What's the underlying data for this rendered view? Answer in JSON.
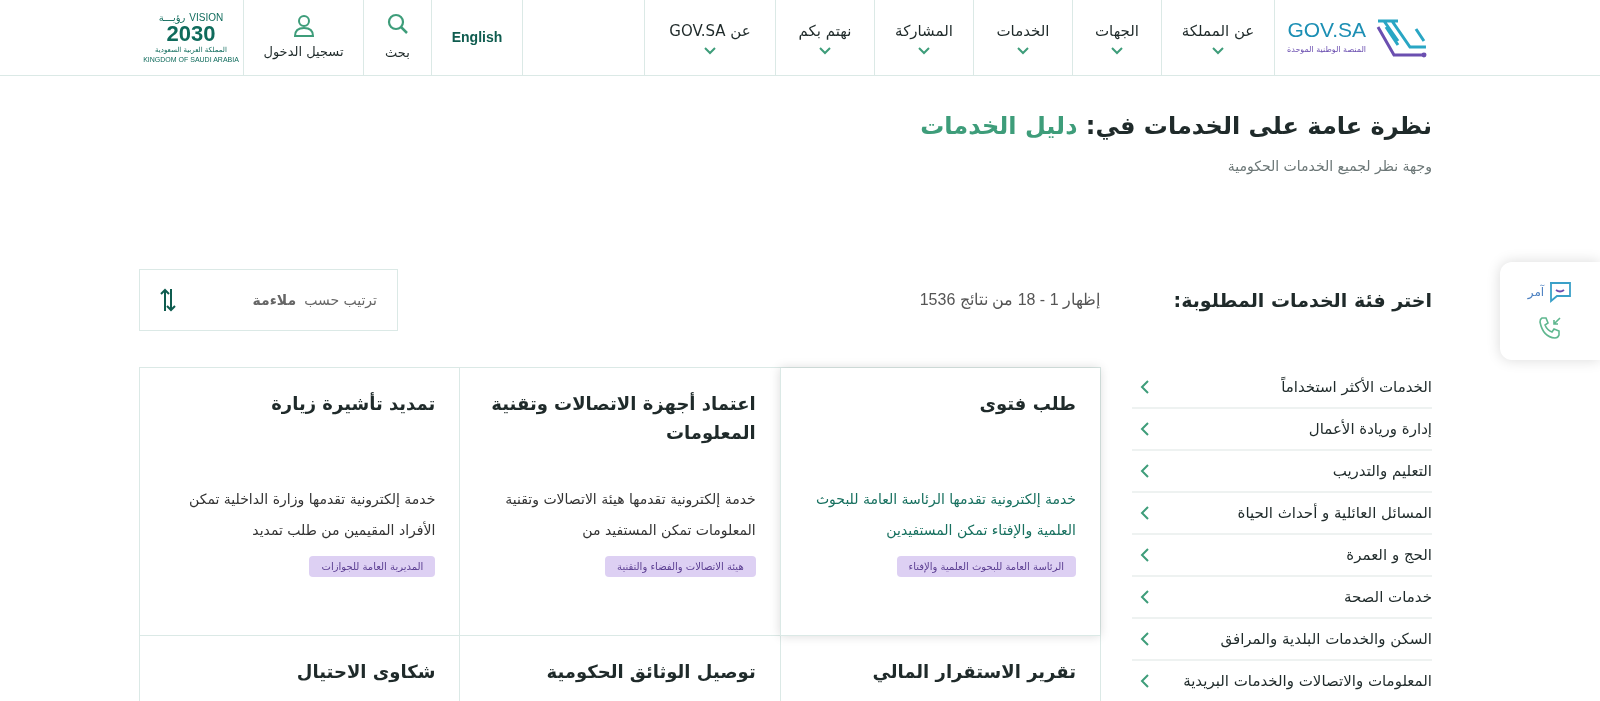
{
  "header": {
    "logo": {
      "name": "GOV.SA",
      "tagline": "المنصة الوطنية الموحدة"
    },
    "nav": [
      {
        "label": "عن المملكة"
      },
      {
        "label": "الجهات"
      },
      {
        "label": "الخدمات"
      },
      {
        "label": "المشاركة"
      },
      {
        "label": "نهتم بكم"
      },
      {
        "label": "عن GOV.SA"
      }
    ],
    "language": "English",
    "search": "بحث",
    "login": "تسجيل الدخول",
    "vision": {
      "word": "VISION",
      "arabic": "رؤيـــة",
      "year": "2030",
      "kingdom_ar": "المملكة العربية السعودية",
      "kingdom_en": "KINGDOM OF SAUDI ARABIA"
    }
  },
  "page": {
    "title": "نظرة عامة على الخدمات في:",
    "title_highlight": "دليل الخدمات",
    "subtitle": "وجهة نظر لجميع الخدمات الحكومية"
  },
  "filter": {
    "heading": "اختر فئة الخدمات المطلوبة:",
    "count": "إظهار 1 - 18 من نتائج 1536",
    "sort_label": "ترتيب حسب",
    "sort_value": "ملاءمة"
  },
  "categories": [
    {
      "label": "الخدمات الأكثر استخداماً"
    },
    {
      "label": "إدارة وريادة الأعمال"
    },
    {
      "label": "التعليم والتدريب"
    },
    {
      "label": "المسائل العائلية و أحداث الحياة"
    },
    {
      "label": "الحج و العمرة"
    },
    {
      "label": "خدمات الصحة"
    },
    {
      "label": "السكن والخدمات البلدية والمرافق"
    },
    {
      "label": "المعلومات والاتصالات والخدمات البريدية"
    }
  ],
  "services": [
    {
      "title": "طلب فتوى",
      "description": "خدمة إلكترونية تقدمها الرئاسة العامة للبحوث العلمية والإفتاء تمكن المستفيدين",
      "agency": "الرئاسة العامة للبحوث العلمية والإفتاء",
      "highlighted": true
    },
    {
      "title": "اعتماد أجهزة الاتصالات وتقنية المعلومات",
      "description": "خدمة إلكترونية تقدمها هيئة الاتصالات وتقنية المعلومات تمكن المستفيد من",
      "agency": "هيئة الاتصالات والفضاء والتقنية",
      "highlighted": false
    },
    {
      "title": "تمديد تأشيرة زيارة",
      "description": "خدمة إلكترونية تقدمها وزارة الداخلية تمكن الأفراد المقيمين من طلب تمديد",
      "agency": "المديرية العامة للجوازات",
      "highlighted": false
    },
    {
      "title": "تقرير الاستقرار المالي",
      "highlighted": false
    },
    {
      "title": "توصيل الوثائق الحكومية",
      "highlighted": false
    },
    {
      "title": "شكاوى الاحتيال",
      "highlighted": false
    }
  ],
  "assistant": {
    "label": "آمر"
  }
}
